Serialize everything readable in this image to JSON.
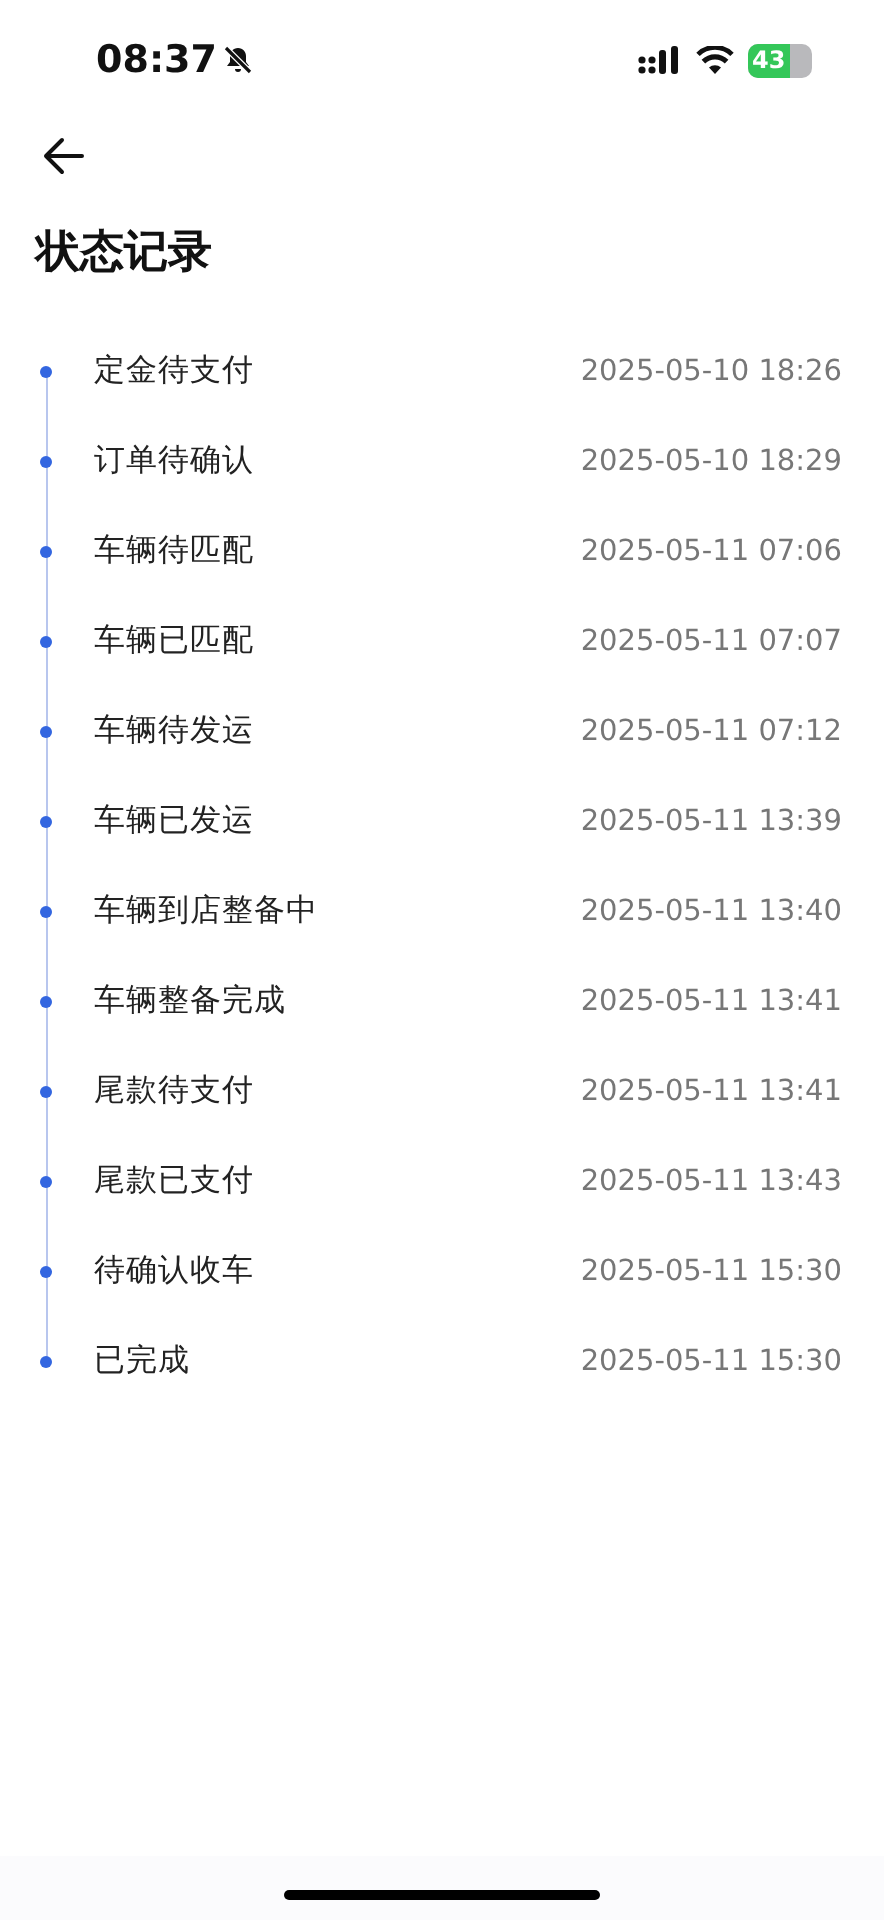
{
  "status_bar": {
    "time": "08:37",
    "battery": "43"
  },
  "title": "状态记录",
  "records": [
    {
      "status": "定金待支付",
      "time": "2025-05-10 18:26"
    },
    {
      "status": "订单待确认",
      "time": "2025-05-10 18:29"
    },
    {
      "status": "车辆待匹配",
      "time": "2025-05-11 07:06"
    },
    {
      "status": "车辆已匹配",
      "time": "2025-05-11 07:07"
    },
    {
      "status": "车辆待发运",
      "time": "2025-05-11 07:12"
    },
    {
      "status": "车辆已发运",
      "time": "2025-05-11 13:39"
    },
    {
      "status": "车辆到店整备中",
      "time": "2025-05-11 13:40"
    },
    {
      "status": "车辆整备完成",
      "time": "2025-05-11 13:41"
    },
    {
      "status": "尾款待支付",
      "time": "2025-05-11 13:41"
    },
    {
      "status": "尾款已支付",
      "time": "2025-05-11 13:43"
    },
    {
      "status": "待确认收车",
      "time": "2025-05-11 15:30"
    },
    {
      "status": "已完成",
      "time": "2025-05-11 15:30"
    }
  ]
}
